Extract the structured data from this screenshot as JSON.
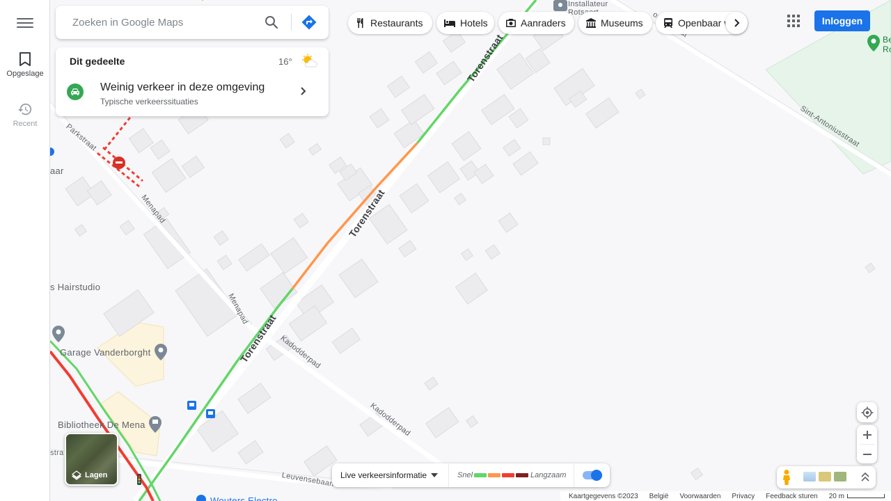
{
  "rail": {
    "menu_icon": "menu-icon",
    "saved_label": "Opgeslage",
    "recent_label": "Recent"
  },
  "search": {
    "placeholder": "Zoeken in Google Maps",
    "value": ""
  },
  "chips": [
    {
      "label": "Restaurants",
      "icon": "fork-knife-icon"
    },
    {
      "label": "Hotels",
      "icon": "bed-icon"
    },
    {
      "label": "Aanraders",
      "icon": "camera-icon"
    },
    {
      "label": "Museums",
      "icon": "museum-icon"
    },
    {
      "label": "Openbaar vervoer",
      "icon": "train-icon"
    }
  ],
  "header": {
    "login_label": "Inloggen"
  },
  "area_card": {
    "title": "Dit gedeelte",
    "temperature": "16°",
    "weather_icon": "partly-cloudy-icon",
    "traffic_title": "Weinig verkeer in deze omgeving",
    "traffic_subtitle": "Typische verkeerssituaties"
  },
  "map_labels": {
    "torenstraat": "Torenstraat",
    "menapad": "Menapad",
    "parkstraat": "Parkstraat",
    "kadodderpad": "Kadodderpad",
    "sint_antonius": "Sint-Antoniusstraat",
    "leuvensebaan": "Leuvensebaan",
    "installateur_1": "Installateur",
    "installateur_2": "Rotsaert",
    "hairstudio": "s Hairstudio",
    "garage": "Garage Vanderborght",
    "bibliotheek": "Bibliotheek De Mena",
    "wouters": "Wouters Electro",
    "aar": "aar",
    "be": "Be",
    "ro": "Ro",
    "stra": "stra"
  },
  "layers": {
    "label": "Lagen"
  },
  "legend": {
    "live_label": "Live verkeersinformatie",
    "fast": "Snel",
    "slow": "Langzaam",
    "colors": [
      "#63d668",
      "#ff974d",
      "#f23c32",
      "#811f1f"
    ],
    "toggle_on": true
  },
  "footer": {
    "copyright": "Kaartgegevens ©2023",
    "country": "België",
    "terms": "Voorwaarden",
    "privacy": "Privacy",
    "feedback": "Feedback sturen",
    "scale": "20 m"
  }
}
